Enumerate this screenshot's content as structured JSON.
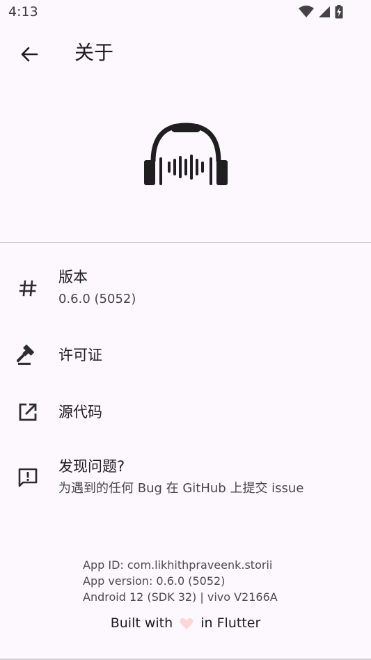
{
  "status_bar": {
    "time": "4:13"
  },
  "app_bar": {
    "title": "关于"
  },
  "items": [
    {
      "title": "版本",
      "subtitle": "0.6.0 (5052)",
      "icon": "hash-icon"
    },
    {
      "title": "许可证",
      "icon": "gavel-icon"
    },
    {
      "title": "源代码",
      "icon": "open-in-new-icon"
    },
    {
      "title": "发现问题?",
      "subtitle": "为遇到的任何 Bug 在 GitHub 上提交 issue",
      "icon": "feedback-icon"
    }
  ],
  "footer": {
    "app_id": "App ID: com.likhithpraveenk.storii",
    "app_version": "App version: 0.6.0 (5052)",
    "device": "Android 12 (SDK 32) | vivo V2166A"
  },
  "built_with": {
    "prefix": "Built with",
    "suffix": "in Flutter"
  },
  "colors": {
    "background": "#fdf8fd",
    "text": "#1c1b1f",
    "heart": "#ffd6d6",
    "divider": "#c7c5ca"
  }
}
